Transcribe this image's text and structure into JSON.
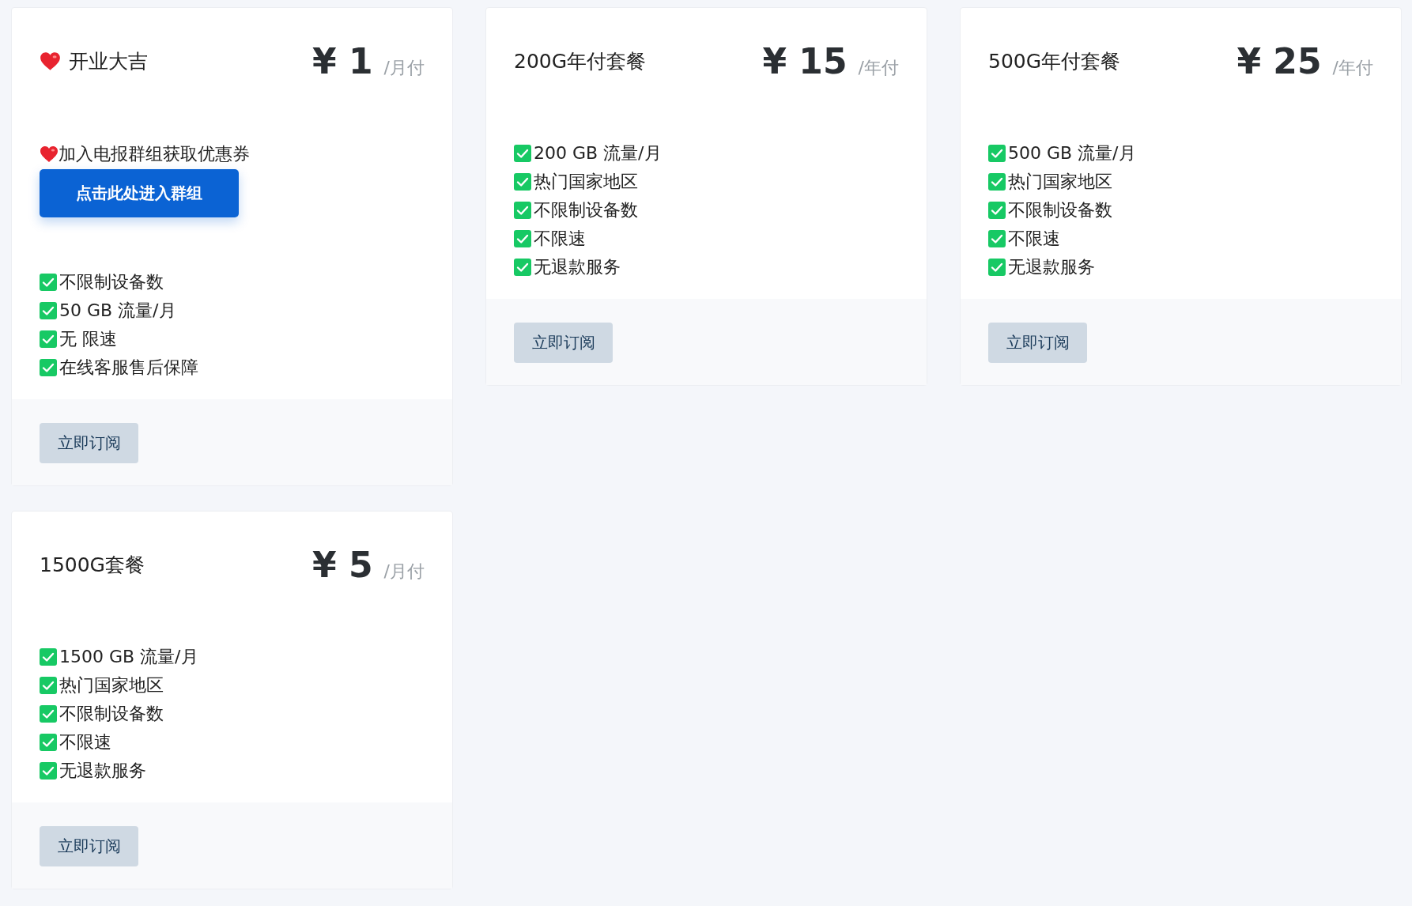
{
  "plans": [
    {
      "kind": "featured",
      "title": "开业大吉",
      "currency": "¥",
      "price": "1",
      "period": "/月付",
      "promo": {
        "text": "加入电报群组获取优惠券",
        "button": "点击此处进入群组"
      },
      "features": [
        "不限制设备数",
        "50 GB 流量/月",
        "无 限速",
        "在线客服售后保障"
      ],
      "subscribe": "立即订阅"
    },
    {
      "kind": "standard",
      "title": "200G年付套餐",
      "currency": "¥",
      "price": "15",
      "period": "/年付",
      "features": [
        "200 GB 流量/月",
        "热门国家地区",
        "不限制设备数",
        "不限速",
        "无退款服务"
      ],
      "subscribe": "立即订阅"
    },
    {
      "kind": "standard",
      "title": "500G年付套餐",
      "currency": "¥",
      "price": "25",
      "period": "/年付",
      "features": [
        "500 GB 流量/月",
        "热门国家地区",
        "不限制设备数",
        "不限速",
        "无退款服务"
      ],
      "subscribe": "立即订阅"
    },
    {
      "kind": "standard",
      "title": "1500G套餐",
      "currency": "¥",
      "price": "5",
      "period": "/月付",
      "features": [
        "1500 GB 流量/月",
        "热门国家地区",
        "不限制设备数",
        "不限速",
        "无退款服务"
      ],
      "subscribe": "立即订阅"
    }
  ]
}
